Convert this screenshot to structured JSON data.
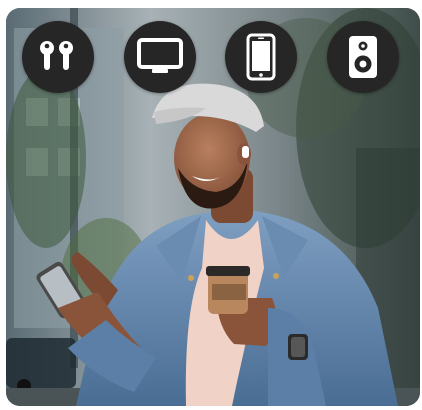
{
  "card": {
    "photo_subject": "man-with-earbuds-phone-and-coffee"
  },
  "device_buttons": [
    {
      "name": "earbuds",
      "icon": "earbuds-icon"
    },
    {
      "name": "tv",
      "icon": "tv-icon"
    },
    {
      "name": "phone",
      "icon": "phone-icon"
    },
    {
      "name": "speaker",
      "icon": "speaker-icon"
    }
  ],
  "colors": {
    "button_bg": "#262626",
    "icon_fg": "#ffffff",
    "jacket": "#5b7fa6",
    "cap": "#d8d8d8",
    "shirt": "#f2d6cc",
    "background_blur": "#6c7d86"
  }
}
